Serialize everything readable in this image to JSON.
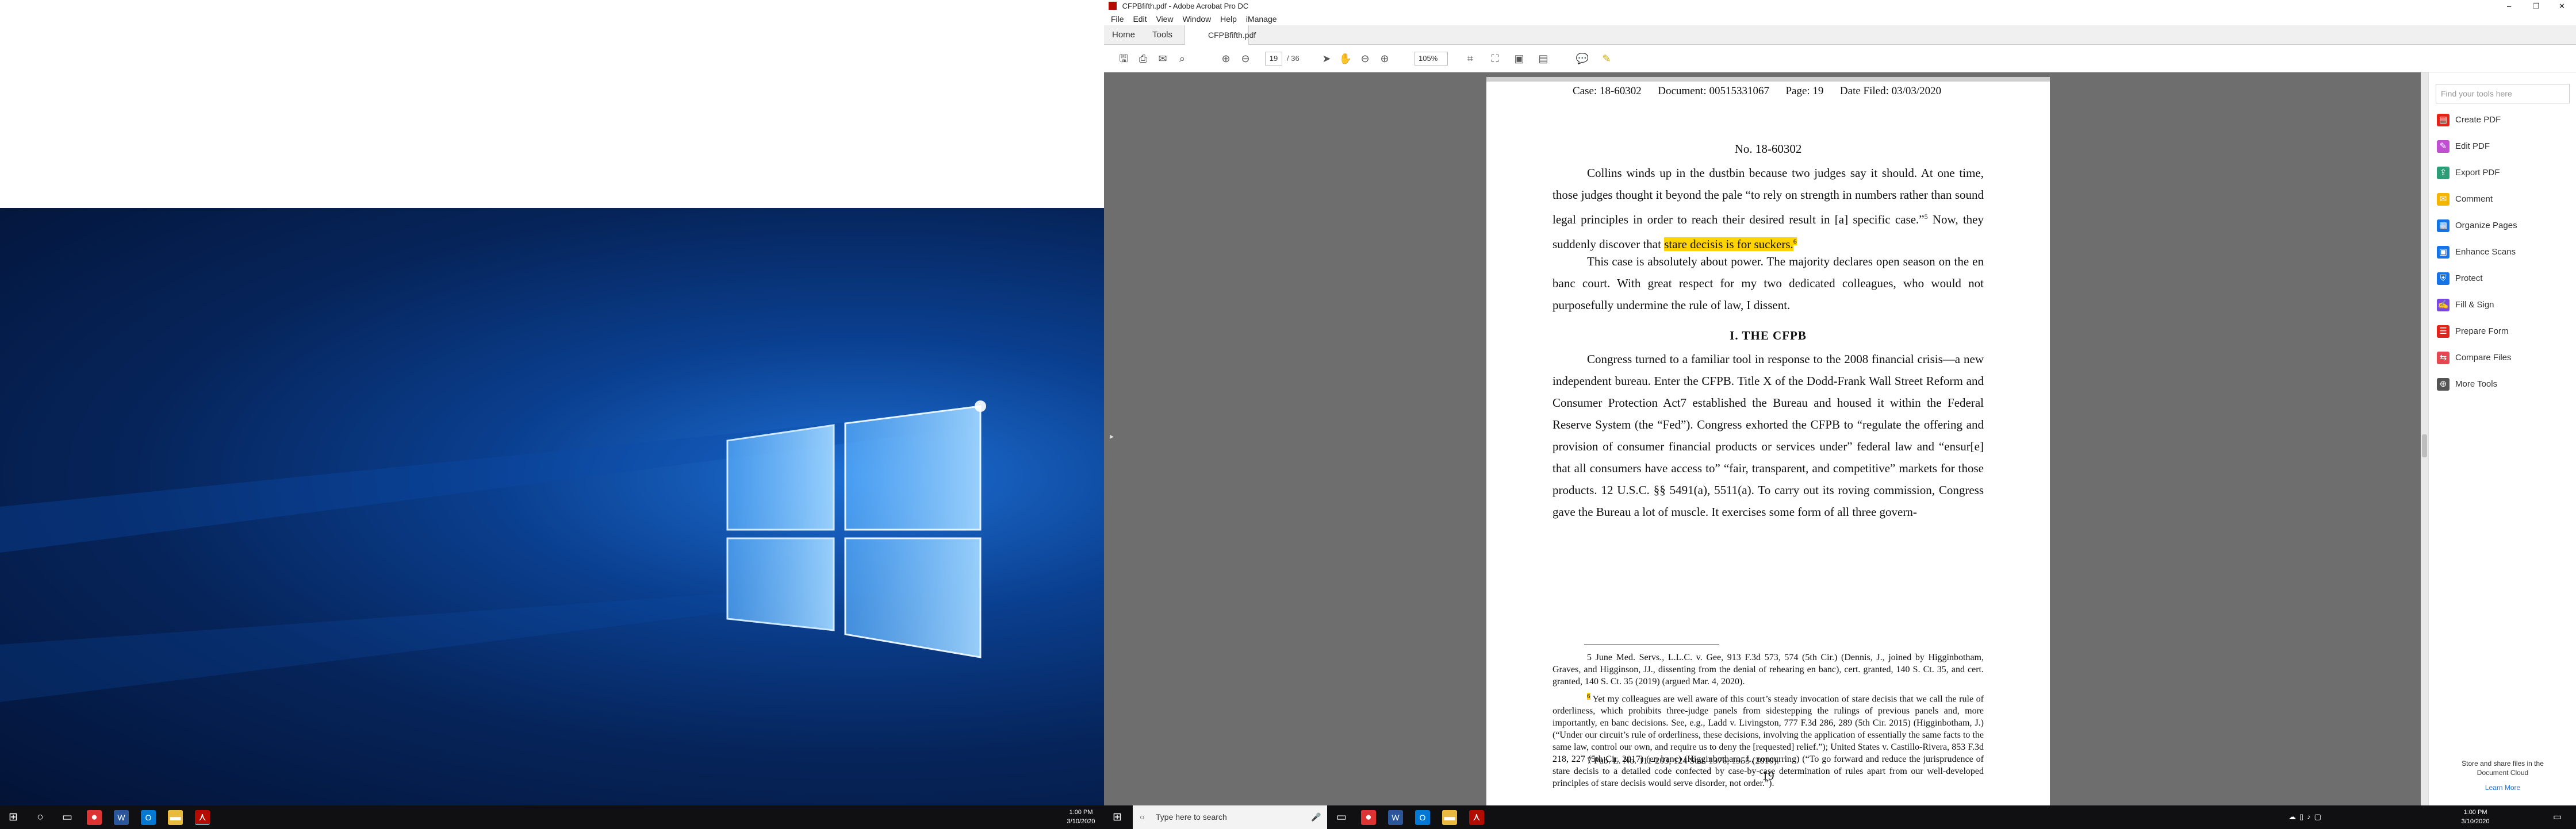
{
  "left_taskbar": {
    "time": "1:00 PM",
    "date": "3/10/2020"
  },
  "window": {
    "title": "CFPBfifth.pdf - Adobe Acrobat Pro DC",
    "min": "–",
    "max": "❐",
    "close": "✕"
  },
  "menu": [
    "File",
    "Edit",
    "View",
    "Window",
    "Help",
    "iManage"
  ],
  "tabs": {
    "home": "Home",
    "tools": "Tools",
    "doc": "CFPBfifth.pdf",
    "doc_close": "×"
  },
  "toolbar": {
    "page_current": "19",
    "page_total": "/ 36",
    "zoom": "105%"
  },
  "right_panel": {
    "search_placeholder": "Find your tools here",
    "tools": [
      {
        "label": "Create PDF",
        "color": "#e2231a"
      },
      {
        "label": "Edit PDF",
        "color": "#c050d0"
      },
      {
        "label": "Export PDF",
        "color": "#2d9d78"
      },
      {
        "label": "Comment",
        "color": "#f5b400"
      },
      {
        "label": "Organize Pages",
        "color": "#1473e6"
      },
      {
        "label": "Enhance Scans",
        "color": "#1473e6"
      },
      {
        "label": "Protect",
        "color": "#1473e6"
      },
      {
        "label": "Fill & Sign",
        "color": "#7a4ae0"
      },
      {
        "label": "Prepare Form",
        "color": "#e2231a"
      },
      {
        "label": "Compare Files",
        "color": "#e34850"
      },
      {
        "label": "More Tools",
        "color": "#555555"
      }
    ],
    "cloud_line1": "Store and share files in the",
    "cloud_line2": "Document Cloud",
    "learn_more": "Learn More"
  },
  "doc": {
    "header": "Case: 18-60302      Document: 00515331067      Page: 19      Date Filed: 03/03/2020",
    "docnum": "No. 18-60302",
    "p1a": "Collins winds up in the dustbin because two judges say it should.  At one time, those judges thought it beyond the pale “to rely on strength in numbers rather than sound legal principles in order to reach their desired result in [a] specific case.”",
    "p1_fn": "5",
    "p1b": "  Now, they suddenly discover that ",
    "p1_hl": "stare decisis is for suckers.",
    "p1_fn2": "6",
    "p2": "This case is absolutely about power.  The majority declares open season on the en banc court.  With great respect for my two dedicated colleagues, who would not purposefully undermine the rule of law, I dissent.",
    "section": "I.  THE CFPB",
    "p3": "Congress turned to a familiar tool in response to the 2008 financial crisis—a new independent bureau.  Enter the CFPB.  Title X of the Dodd-Frank Wall Street Reform and Consumer Protection Act7 established the Bureau and housed it within the Federal Reserve System (the “Fed”).  Congress exhorted the CFPB to “regulate the offering and provision of consumer financial products or services under” federal law and “ensur[e] that all consumers have access to” “fair, transparent, and competitive” markets for those products. 12 U.S.C. §§ 5491(a), 5511(a).  To carry out its roving commission, Congress gave the Bureau a lot of muscle.  It exercises some form of all three govern-",
    "fn5": "5 June Med. Servs., L.L.C. v. Gee, 913 F.3d 573, 574 (5th Cir.) (Dennis, J., joined by Higginbotham, Graves, and Higginson, JJ., dissenting from the denial of rehearing en banc), cert. granted, 140 S. Ct. 35, and cert. granted, 140 S. Ct. 35 (2019) (argued Mar. 4, 2020).",
    "fn6_num": "6",
    "fn6": " Yet my colleagues are well aware of this court’s steady invocation of stare decisis that we call the rule of orderliness, which prohibits three-judge panels from sidestepping the rulings of previous panels and, more importantly, en banc decisions.  See, e.g., Ladd v. Livingston, 777 F.3d 286, 289 (5th Cir. 2015) (Higginbotham, J.) (“Under our circuit’s rule of orderliness, these decisions, involving the application of essentially the same facts to the same law, control our own, and require us to deny the [requested] relief.”); United States v. Castillo-Rivera, 853 F.3d 218, 227 (5th Cir. 2017) (en banc) (Higginbotham, J., concurring) (“To go forward and reduce the jurisprudence of stare decisis to a detailed code confected by case-by-case determination of rules apart from our well-developed principles of stare decisis would serve disorder, not order.”).",
    "fn7": "7 Pub. L. No. 111-203, 124 Stat. 1376, 1955 (2010).",
    "page_number": "19"
  },
  "right_taskbar": {
    "search": "Type here to search",
    "time": "1:00 PM",
    "date": "3/10/2020"
  }
}
